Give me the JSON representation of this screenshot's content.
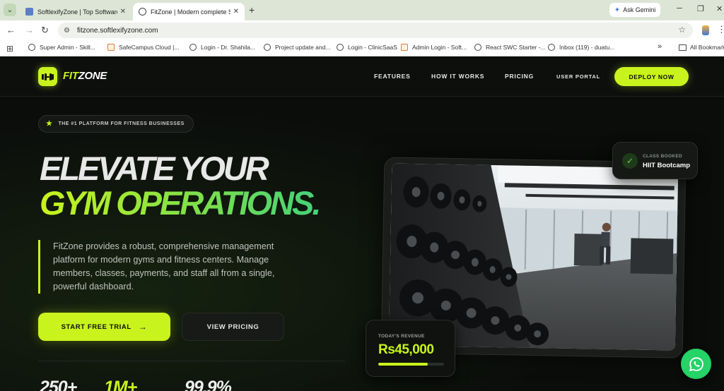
{
  "browser": {
    "tabs": [
      {
        "title": "SoftlexifyZone | Top Software D",
        "active": false
      },
      {
        "title": "FitZone | Modern complete Saa",
        "active": true
      }
    ],
    "gemini_label": "Ask Gemini",
    "url": "fitzone.softlexifyzone.com",
    "bookmarks": [
      "Super Admin - Skill...",
      "SafeCampus Cloud |...",
      "Login - Dr. Shahila...",
      "Project update and...",
      "Login - ClinicSaaS",
      "Admin Login - Soft...",
      "React SWC Starter -...",
      "Inbox (119) - duatu..."
    ],
    "more_bookmarks": "»",
    "all_bookmarks": "All Bookmarks"
  },
  "site": {
    "logo": {
      "fit": "FIT",
      "zone": "ZONE"
    },
    "nav": [
      "FEATURES",
      "HOW IT WORKS",
      "PRICING",
      "USER PORTAL"
    ],
    "deploy_label": "DEPLOY NOW",
    "badge": "THE #1 PLATFORM FOR FITNESS BUSINESSES",
    "headline_line1": "ELEVATE YOUR",
    "headline_line2": "GYM OPERATIONS.",
    "description": "FitZone provides a robust, comprehensive management platform for modern gyms and fitness centers. Manage members, classes, payments, and staff all from a single, powerful dashboard.",
    "cta_primary": "START FREE TRIAL",
    "cta_secondary": "VIEW PRICING",
    "stats": [
      "250+",
      "1M+",
      "99.9%"
    ],
    "class_booked": {
      "label": "CLASS BOOKED",
      "value": "HIIT Bootcamp"
    },
    "revenue": {
      "label": "TODAY'S REVENUE",
      "value": "Rs45,000",
      "progress": 0.75
    }
  },
  "colors": {
    "accent": "#c9f31d",
    "background": "#0b0d0b",
    "whatsapp": "#25d366"
  }
}
